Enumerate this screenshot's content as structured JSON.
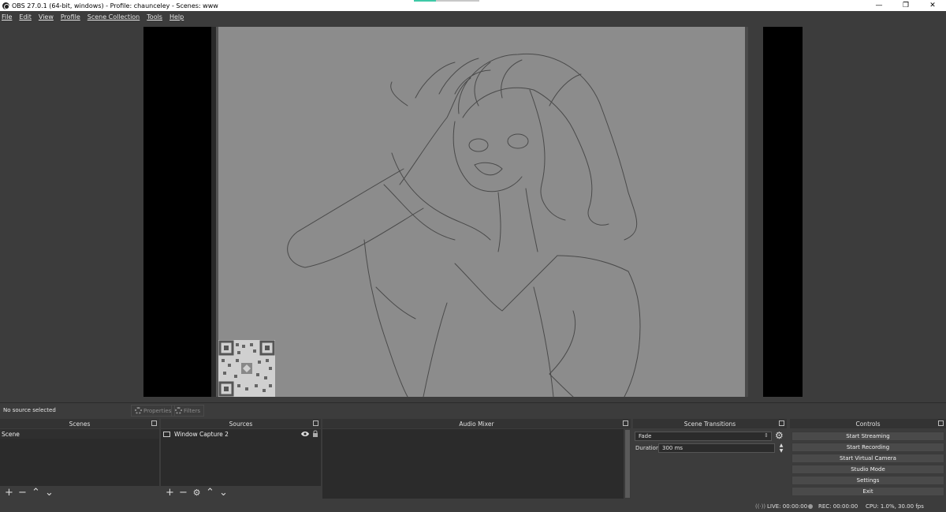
{
  "window": {
    "title": "OBS 27.0.1 (64-bit, windows) - Profile: chaunceley - Scenes: www",
    "controls": [
      "—",
      "❐",
      "✕"
    ]
  },
  "menu": [
    "File",
    "Edit",
    "View",
    "Profile",
    "Scene Collection",
    "Tools",
    "Help"
  ],
  "context": {
    "no_source": "No source selected",
    "properties_label": "Properties",
    "filters_label": "Filters"
  },
  "scenes": {
    "title": "Scenes",
    "items": [
      "Scene"
    ]
  },
  "sources": {
    "title": "Sources",
    "items": [
      {
        "label": "Window Capture 2"
      }
    ]
  },
  "mixer": {
    "title": "Audio Mixer"
  },
  "transitions": {
    "title": "Scene Transitions",
    "selected": "Fade",
    "duration_label": "Duration",
    "duration_value": "300 ms"
  },
  "controls": {
    "title": "Controls",
    "buttons": [
      "Start Streaming",
      "Start Recording",
      "Start Virtual Camera",
      "Studio Mode",
      "Settings",
      "Exit"
    ]
  },
  "status": {
    "live": "LIVE: 00:00:00",
    "rec": "REC: 00:00:00",
    "cpu": "CPU: 1.0%, 30.00 fps"
  },
  "icons": {
    "app": "obs-logo-icon",
    "add": "plus-icon",
    "remove": "minus-icon",
    "up": "chevron-up-icon",
    "down": "chevron-down-icon",
    "gear": "gear-icon",
    "eye": "eye-icon",
    "lock": "lock-icon",
    "undock": "undock-icon"
  },
  "colors": {
    "background": "#3c3c3c",
    "panel": "#2b2b2b",
    "canvas": "#8c8c8c",
    "accent": "#3ec9a7"
  }
}
